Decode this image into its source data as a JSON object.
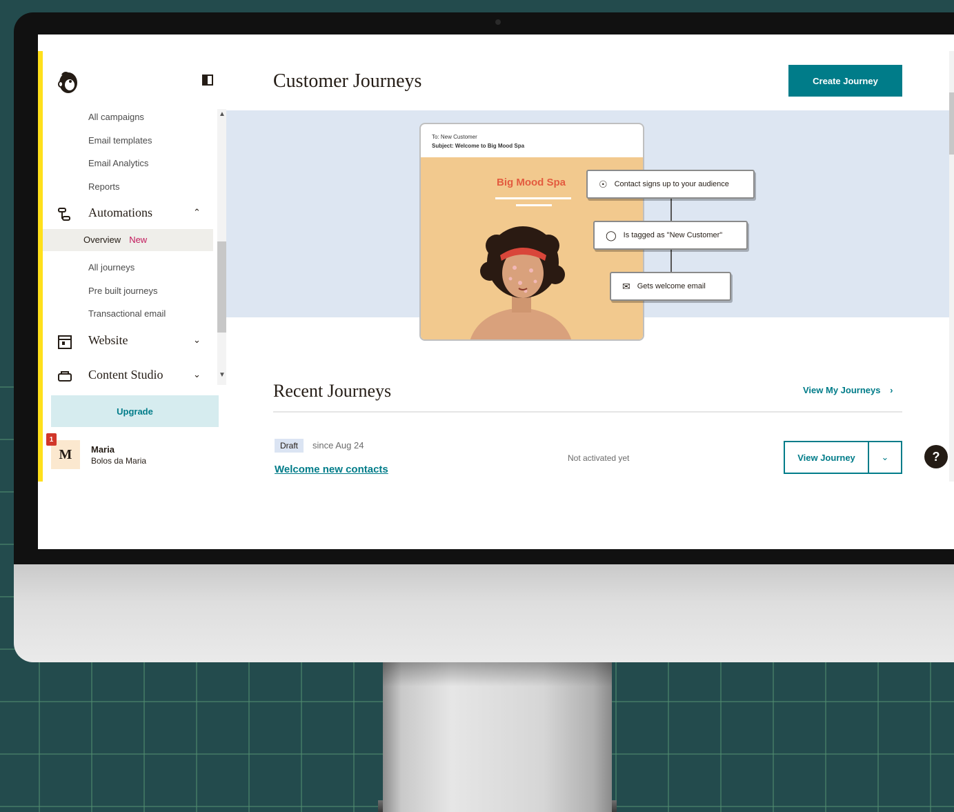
{
  "sidebar": {
    "campaign_subitems": [
      "All campaigns",
      "Email templates",
      "Email Analytics",
      "Reports"
    ],
    "automations": {
      "label": "Automations",
      "subitems": {
        "overview": "Overview",
        "overview_badge": "New",
        "all_journeys": "All journeys",
        "prebuilt": "Pre built journeys",
        "transactional": "Transactional email"
      }
    },
    "website": {
      "label": "Website"
    },
    "content_studio": {
      "label": "Content Studio"
    },
    "upgrade_label": "Upgrade",
    "user": {
      "initial": "M",
      "notification_count": "1",
      "name": "Maria",
      "org": "Bolos da Maria"
    }
  },
  "header": {
    "title": "Customer Journeys",
    "create_label": "Create Journey"
  },
  "hero": {
    "email_to": "To: New Customer",
    "email_subject": "Subject: Welcome to Big Mood Spa",
    "spa_name": "Big Mood Spa",
    "flow_steps": [
      "Contact signs up to your audience",
      "Is tagged as \"New Customer\"",
      "Gets welcome email"
    ]
  },
  "recent": {
    "title": "Recent Journeys",
    "view_all_label": "View My Journeys",
    "journey": {
      "badge": "Draft",
      "since": "since Aug 24",
      "name": "Welcome new contacts",
      "status": "Not activated yet",
      "view_label": "View Journey"
    }
  },
  "help_label": "?"
}
